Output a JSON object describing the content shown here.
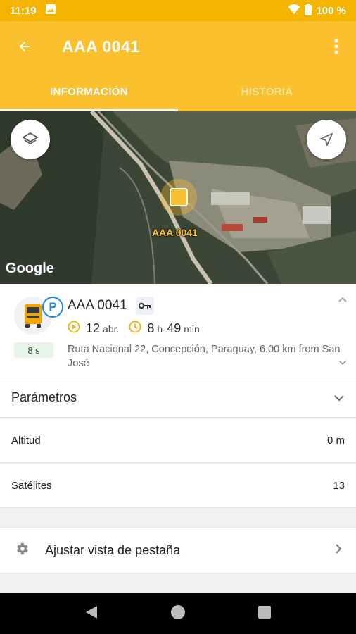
{
  "status_bar": {
    "time": "11:19",
    "battery": "100 %"
  },
  "app_bar": {
    "title": "AAA 0041"
  },
  "tabs": [
    {
      "label": "INFORMACIÓN",
      "active": true
    },
    {
      "label": "HISTORIA",
      "active": false
    }
  ],
  "map": {
    "unit_label": "AAA 0041",
    "attribution": "Google"
  },
  "unit": {
    "name": "AAA 0041",
    "parking_badge": "P",
    "last_update": "8 s",
    "stat_date_value": "12",
    "stat_date_unit": "abr.",
    "stat_duration_h": "8",
    "stat_duration_h_unit": "h",
    "stat_duration_m": "49",
    "stat_duration_m_unit": "min",
    "address": "Ruta Nacional 22, Concepción, Paraguay, 6.00 km from San José"
  },
  "parameters": {
    "title": "Parámetros",
    "rows": [
      {
        "label": "Altitud",
        "value": "0 m"
      },
      {
        "label": "Satélites",
        "value": "13"
      }
    ]
  },
  "settings": {
    "label": "Ajustar vista de pestaña"
  },
  "colors": {
    "accent": "#fbc02d",
    "status": "#f4b400",
    "parking": "#1e88e5"
  },
  "icons": [
    "back-arrow-icon",
    "more-vert-icon",
    "layers-icon",
    "navigation-icon",
    "truck-icon",
    "key-icon",
    "play-clock-icon",
    "clock-icon",
    "chevron-up-icon",
    "chevron-down-icon",
    "gear-icon",
    "chevron-right-icon"
  ]
}
